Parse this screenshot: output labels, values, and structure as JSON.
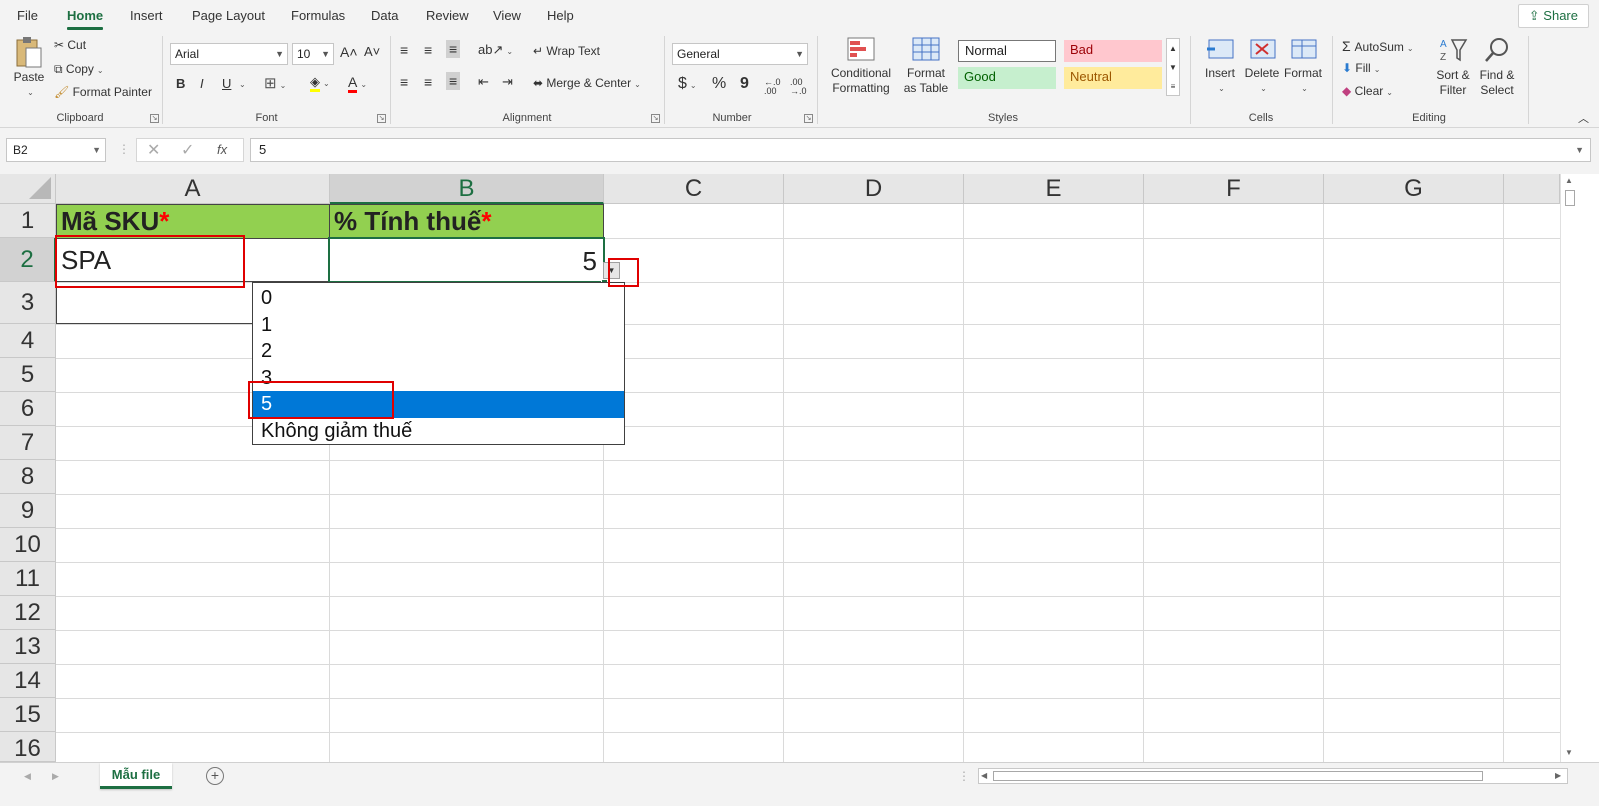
{
  "ribbon_tabs": [
    "File",
    "Home",
    "Insert",
    "Page Layout",
    "Formulas",
    "Data",
    "Review",
    "View",
    "Help"
  ],
  "share_label": "Share",
  "clipboard": {
    "paste": "Paste",
    "cut": "Cut",
    "copy": "Copy",
    "format_painter": "Format Painter",
    "label": "Clipboard"
  },
  "font": {
    "name": "Arial",
    "size": "10",
    "label": "Font",
    "bold": "B",
    "italic": "I",
    "underline": "U",
    "font_color_glyph": "A"
  },
  "alignment": {
    "wrap_text": "Wrap Text",
    "merge_center": "Merge & Center",
    "label": "Alignment"
  },
  "number": {
    "format": "General",
    "currency": "$",
    "percent": "%",
    "comma": "9",
    "inc_decimal": "←.0 .00",
    "dec_decimal": ".00 →.0",
    "label": "Number"
  },
  "styles": {
    "conditional_formatting": "Conditional Formatting",
    "format_as_table": "Format as Table",
    "normal": "Normal",
    "bad": "Bad",
    "good": "Good",
    "neutral": "Neutral",
    "label": "Styles"
  },
  "cells": {
    "insert": "Insert",
    "delete": "Delete",
    "format": "Format",
    "label": "Cells"
  },
  "editing": {
    "autosum": "AutoSum",
    "fill": "Fill",
    "clear": "Clear",
    "sort_filter": "Sort & Filter",
    "find_select": "Find & Select",
    "label": "Editing"
  },
  "formula_bar": {
    "name_box": "B2",
    "fx": "fx",
    "value": "5"
  },
  "columns": [
    "A",
    "B",
    "C",
    "D",
    "E",
    "F",
    "G"
  ],
  "rows": [
    "1",
    "2",
    "3",
    "4",
    "5",
    "6",
    "7",
    "8",
    "9",
    "10",
    "11",
    "12",
    "13",
    "14",
    "15",
    "16"
  ],
  "cells_data": {
    "A1": "Mã SKU",
    "A1_star": "*",
    "B1": "% Tính thuế",
    "B1_star": "*",
    "A2": "SPA",
    "B2": "5"
  },
  "dropdown": {
    "options": [
      "0",
      "1",
      "2",
      "3",
      "5",
      "Không giảm thuế"
    ],
    "selected": "5"
  },
  "sheets": {
    "active": "Mẫu file"
  },
  "colors": {
    "accent": "#1d6f42",
    "header_fill": "#92d050",
    "selection": "#0078d7",
    "highlight": "#e00000"
  }
}
